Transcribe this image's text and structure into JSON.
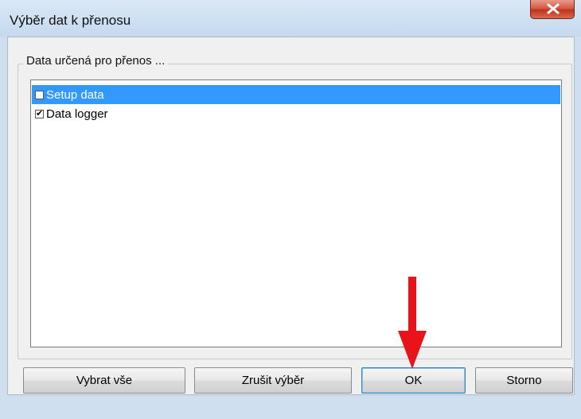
{
  "window": {
    "title": "Výběr dat k přenosu",
    "close_icon": "close-icon"
  },
  "group": {
    "label": "Data určená pro přenos ..."
  },
  "list": {
    "items": [
      {
        "label": "Setup data",
        "checked": false,
        "selected": true
      },
      {
        "label": "Data logger",
        "checked": true,
        "selected": false
      }
    ]
  },
  "buttons": {
    "select_all": "Vybrat vše",
    "deselect": "Zrušit výběr",
    "ok": "OK",
    "cancel": "Storno"
  },
  "annotation": {
    "arrow_icon": "arrow-down-icon",
    "color": "#e8141a"
  }
}
